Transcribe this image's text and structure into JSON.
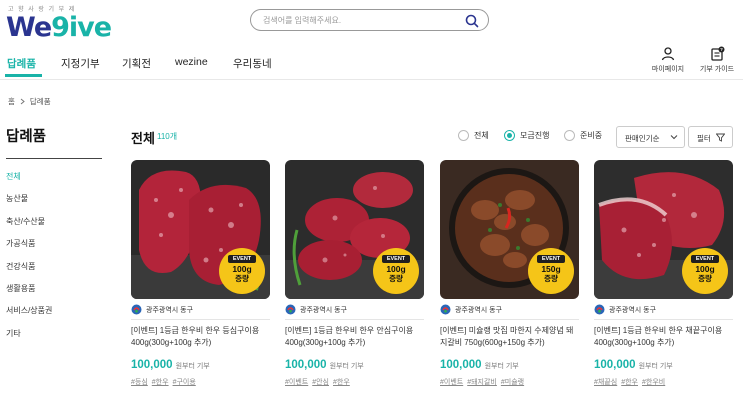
{
  "header": {
    "logo_subtitle": "고향사랑기부제",
    "logo_text_a": "We",
    "logo_text_b": "9ive",
    "search_placeholder": "검색어를 입력해주세요.",
    "nav": [
      "답례품",
      "지정기부",
      "기획전",
      "wezine",
      "우리동네"
    ],
    "util": {
      "mypage": "마이페이지",
      "guide": "기부 가이드"
    }
  },
  "breadcrumb": {
    "home": "홈",
    "current": "답례품"
  },
  "sidebar": {
    "title": "답례품",
    "items": [
      "전체",
      "농산물",
      "축산/수산물",
      "가공식품",
      "건강식품",
      "생활용품",
      "서비스/상품권",
      "기타"
    ]
  },
  "content": {
    "title": "전체",
    "count": "110개",
    "radios": [
      {
        "label": "전체",
        "checked": false
      },
      {
        "label": "모금진행",
        "checked": true
      },
      {
        "label": "준비중",
        "checked": false
      }
    ],
    "sort_label": "판매인기순",
    "filter_label": "필터"
  },
  "cards": [
    {
      "badge_event": "EVENT",
      "badge_amount": "100g",
      "badge_weight": "증량",
      "region": "광주광역시 동구",
      "name": "[이벤트] 1등급 한우비 한우 등심구이용 400g(300g+100g 추가)",
      "price": "100,000",
      "price_unit": "원부터 기부",
      "tags": [
        "#등심",
        "#한우",
        "#구이용"
      ],
      "image": "raw-sirloin"
    },
    {
      "badge_event": "EVENT",
      "badge_amount": "100g",
      "badge_weight": "증량",
      "region": "광주광역시 동구",
      "name": "[이벤트] 1등급 한우비 한우 안심구이용 400g(300g+100g 추가)",
      "price": "100,000",
      "price_unit": "원부터 기부",
      "tags": [
        "#이벤트",
        "#안심",
        "#한우"
      ],
      "image": "raw-tenderloin"
    },
    {
      "badge_event": "EVENT",
      "badge_amount": "150g",
      "badge_weight": "증량",
      "region": "광주광역시 동구",
      "name": "[이벤트] 미슐랭 맛집 마한지 수제양념 돼지갈비 750g(600g+150g 추가)",
      "price": "100,000",
      "price_unit": "원부터 기부",
      "tags": [
        "#이벤트",
        "#돼지갈비",
        "#미슐랭"
      ],
      "image": "marinated-pork-ribs"
    },
    {
      "badge_event": "EVENT",
      "badge_amount": "100g",
      "badge_weight": "증량",
      "region": "광주광역시 동구",
      "name": "[이벤트] 1등급 한우비 한우 채끝구이용 400g(300g+100g 추가)",
      "price": "100,000",
      "price_unit": "원부터 기부",
      "tags": [
        "#채끝심",
        "#한우",
        "#한우비"
      ],
      "image": "raw-striploin"
    }
  ],
  "colors": {
    "accent": "#19b3a8",
    "brand": "#2b3590",
    "badge": "#f5c518"
  }
}
